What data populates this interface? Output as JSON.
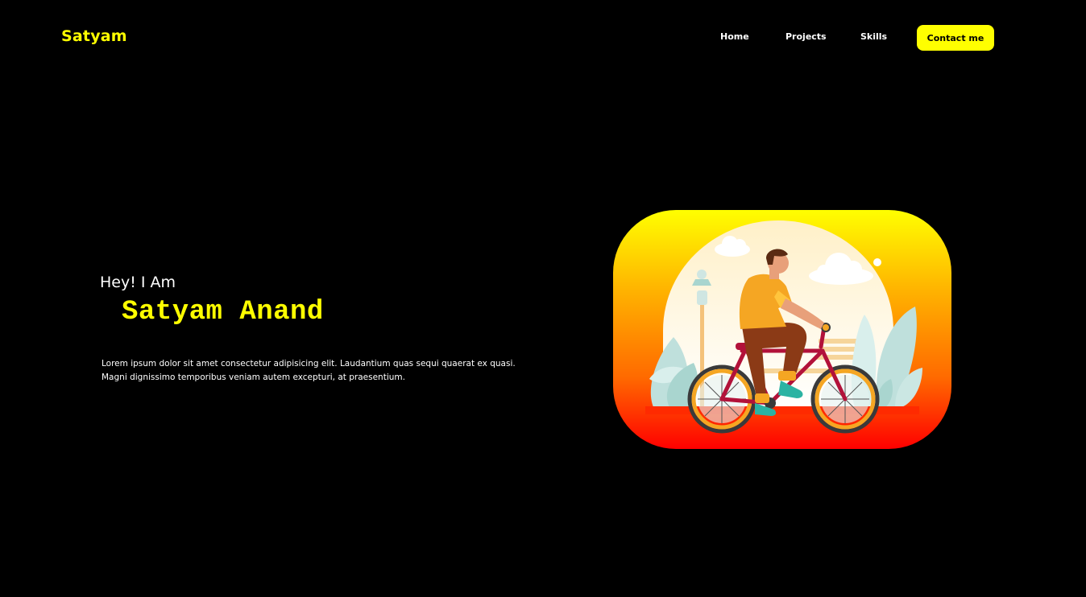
{
  "header": {
    "logo": "Satyam",
    "nav": {
      "home": "Home",
      "projects": "Projects",
      "skills": "Skills",
      "contact": "Contact me"
    }
  },
  "hero": {
    "greeting": "Hey! I Am",
    "name": "Satyam Anand",
    "description": "Lorem ipsum dolor sit amet consectetur adipisicing elit. Laudantium quas sequi quaerat ex quasi. Magni dignissimo temporibus veniam autem excepturi, at praesentium."
  },
  "colors": {
    "background": "#000000",
    "accent": "#ffff00",
    "text": "#ffffff",
    "card_gradient_top": "#ffff00",
    "card_gradient_bottom": "#ff0000"
  },
  "icons": {
    "illustration": "cyclist-illustration"
  }
}
